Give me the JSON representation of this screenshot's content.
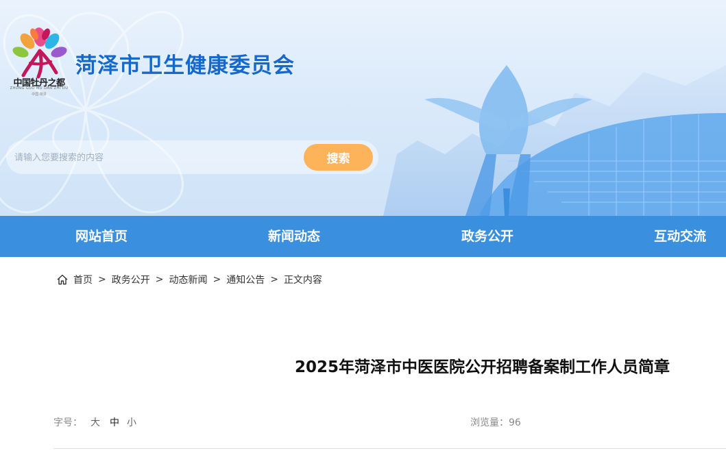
{
  "header": {
    "logo_text": "中国牡丹之都",
    "logo_subtext": "ZHONG GUO MU DAN ZHI DU",
    "logo_location": "中国·菏泽",
    "site_title": "菏泽市卫生健康委员会"
  },
  "search": {
    "placeholder": "请输入您要搜索的内容",
    "value": "",
    "button_label": "搜索"
  },
  "nav": {
    "items": [
      {
        "label": "网站首页"
      },
      {
        "label": "新闻动态"
      },
      {
        "label": "政务公开"
      },
      {
        "label": "互动交流"
      }
    ]
  },
  "breadcrumb": {
    "icon": "home-icon",
    "items": [
      "首页",
      "政务公开",
      "动态新闻",
      "通知公告",
      "正文内容"
    ],
    "separator": ">"
  },
  "article": {
    "title": "2025年菏泽市中医医院公开招聘备案制工作人员简章",
    "font_size_label": "字号：",
    "font_sizes": [
      "大",
      "中",
      "小"
    ],
    "active_font_size": "中",
    "views_text": "浏览量：96"
  },
  "colors": {
    "accent": "#1668c9",
    "nav_bg": "#3a8fde",
    "search_button": "#fdb35a"
  }
}
